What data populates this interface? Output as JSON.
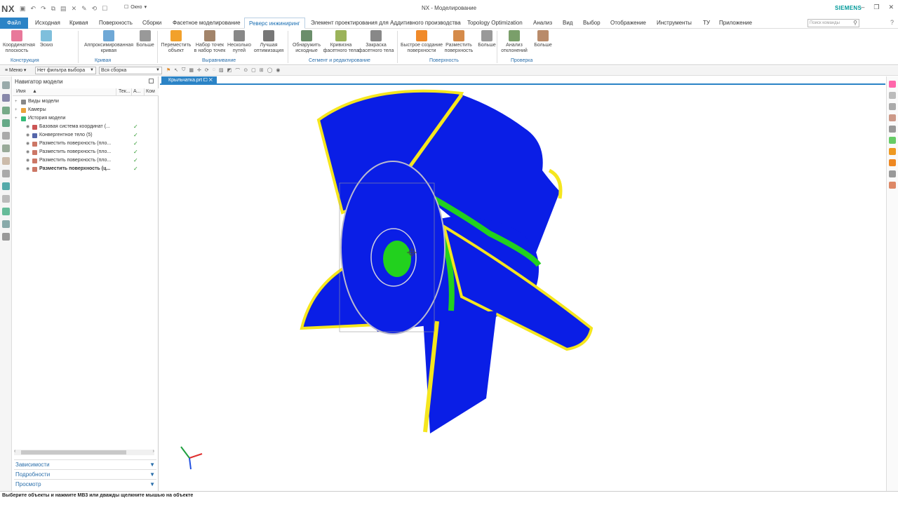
{
  "app": {
    "logo": "NX",
    "title": "NX - Моделирование",
    "brand": "SIEMENS",
    "window_menu_label": "Окно"
  },
  "menu": {
    "tabs": [
      "Файл",
      "Исходная",
      "Кривая",
      "Поверхность",
      "Сборки",
      "Фасетное моделирование",
      "Реверс инжиниринг",
      "Элемент проектирования для Аддитивного производства",
      "Topology Optimization",
      "Анализ",
      "Вид",
      "Выбор",
      "Отображение",
      "Инструменты",
      "ТУ",
      "Приложение"
    ],
    "active": "Реверс инжиниринг",
    "search_placeholder": "Поиск команды"
  },
  "ribbon": {
    "buttons": [
      {
        "label": "Координатная\nплоскость",
        "color": "#e8789a"
      },
      {
        "label": "Эскиз",
        "color": "#7fbfdc"
      },
      {
        "label": "Аппроксимированная\nкривая",
        "color": "#6fa8d6"
      },
      {
        "label": "Больше",
        "color": "#999999"
      },
      {
        "label": "Переместить\nобъект",
        "color": "#f2a12b"
      },
      {
        "label": "Набор точек\nв набор точек",
        "color": "#a2846a"
      },
      {
        "label": "Несколько\nпутей",
        "color": "#888888"
      },
      {
        "label": "Лучшая\nоптимизация",
        "color": "#777777"
      },
      {
        "label": "Обнаружить\nисходные",
        "color": "#6b8e6b"
      },
      {
        "label": "Кривизна\nфасетного тела",
        "color": "#9bb35a"
      },
      {
        "label": "Закраска\nфасетного тела",
        "color": "#888888"
      },
      {
        "label": "Быстрое создание\nповерхности",
        "color": "#f08a2a"
      },
      {
        "label": "Разместить\nповерхность",
        "color": "#d58b4a"
      },
      {
        "label": "Больше",
        "color": "#999999"
      },
      {
        "label": "Анализ\nотклонений",
        "color": "#7a9f6a"
      },
      {
        "label": "Больше",
        "color": "#b98b6a"
      }
    ],
    "groups": [
      "Конструкция",
      "Кривая",
      "Выравнивание",
      "Сегмент и редактирование",
      "Поверхность",
      "Проверка"
    ]
  },
  "selection_bar": {
    "menu_label": "Меню",
    "filter": "Нет фильтра выбора",
    "scope": "Вся сборка"
  },
  "navigator": {
    "title": "Навигатор модели",
    "columns": [
      "Имя",
      "Тек...",
      "А...",
      "Ком"
    ],
    "rows": [
      {
        "label": "Виды модели",
        "checked": false,
        "bold": false
      },
      {
        "label": "Камеры",
        "checked": false,
        "bold": false
      },
      {
        "label": "История модели",
        "checked": false,
        "bold": false
      },
      {
        "label": "Базовая система координат (...",
        "checked": true,
        "bold": false
      },
      {
        "label": "Конвергентное тело (5)",
        "checked": true,
        "bold": false
      },
      {
        "label": "Разместить поверхность (пло...",
        "checked": true,
        "bold": false
      },
      {
        "label": "Разместить поверхность (пло...",
        "checked": true,
        "bold": false
      },
      {
        "label": "Разместить поверхность (пло...",
        "checked": true,
        "bold": false
      },
      {
        "label": "Разместить поверхность (ц...",
        "checked": true,
        "bold": true
      }
    ],
    "accordions": [
      "Зависимости",
      "Подробности",
      "Просмотр"
    ]
  },
  "graphics": {
    "tab_label": "Крыльчатка.prt",
    "colors": {
      "blue": "#0a1ee6",
      "yellow": "#f5e61e",
      "green": "#22d11e"
    }
  },
  "status": {
    "text": "Выберите объекты и нажмите MB3 или дважды щелкните мышью на объекте"
  }
}
